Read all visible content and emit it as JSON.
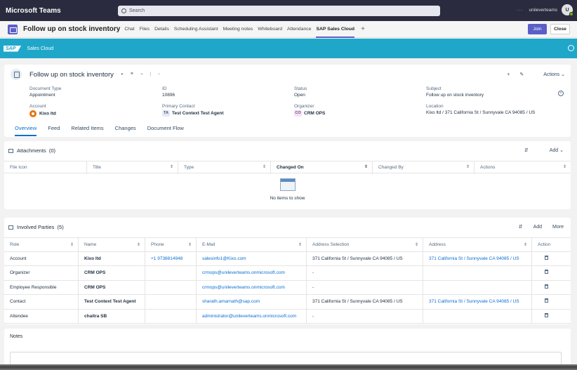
{
  "teams": {
    "title": "Microsoft Teams",
    "search_placeholder": "Search",
    "more": "···",
    "tenant": "unileverteams",
    "avatar_initial": "U"
  },
  "meeting": {
    "title": "Follow up on stock inventory",
    "tabs": [
      "Chat",
      "Files",
      "Details",
      "Scheduling Assistant",
      "Meeting notes",
      "Whiteboard",
      "Attendance",
      "SAP Sales Cloud"
    ],
    "active_tab": "SAP Sales Cloud",
    "add": "+",
    "join": "Join",
    "close": "Close"
  },
  "sap": {
    "logo": "SAP",
    "app": "Sales Cloud"
  },
  "header": {
    "title": "Follow up on stock inventory",
    "actions_label": "Actions",
    "fields": {
      "document_type": {
        "label": "Document Type",
        "value": "Appointment"
      },
      "id": {
        "label": "ID",
        "value": "10896"
      },
      "status": {
        "label": "Status",
        "value": "Open"
      },
      "subject": {
        "label": "Subject",
        "value": "Follow up on stock inventory"
      },
      "account": {
        "label": "Account",
        "value": "Kixo ltd"
      },
      "primary_contact": {
        "label": "Primary Contact",
        "value": "Test Context Test Agent",
        "initials": "TA"
      },
      "organizer": {
        "label": "Organizer",
        "value": "CRM OPS",
        "initials": "CO"
      },
      "location": {
        "label": "Location",
        "value": "Kixo ltd / 371 California St / Sunnyvale CA 94085 / US"
      }
    },
    "tabs": [
      "Overview",
      "Feed",
      "Related Items",
      "Changes",
      "Document Flow"
    ],
    "active_tab": "Overview"
  },
  "attachments": {
    "title": "Attachments",
    "count": "(0)",
    "add": "Add",
    "columns": [
      "File Icon",
      "Title",
      "Type",
      "Changed On",
      "Changed By",
      "Actions"
    ],
    "empty_text": "No items to show"
  },
  "parties": {
    "title": "Involved Parties",
    "count": "(5)",
    "add": "Add",
    "more": "More",
    "columns": [
      "Role",
      "Name",
      "Phone",
      "E-Mail",
      "Address Selection",
      "Address",
      "Action"
    ],
    "rows": [
      {
        "role": "Account",
        "name": "Kixo ltd",
        "phone": "+1 9738814948",
        "email": "salesinfo1@Kixo.com",
        "address_selection": "371 California St / Sunnyvale CA 94085 / US",
        "address": "371 California St / Sunnyvale CA 94085 / US"
      },
      {
        "role": "Organizer",
        "name": "CRM OPS",
        "phone": "",
        "email": "crmops@unileverteams.onmicrosoft.com",
        "address_selection": "-",
        "address": ""
      },
      {
        "role": "Employee Responsible",
        "name": "CRM OPS",
        "phone": "",
        "email": "crmops@unileverteams.onmicrosoft.com",
        "address_selection": "-",
        "address": ""
      },
      {
        "role": "Contact",
        "name": "Test Context Test Agent",
        "phone": "",
        "email": "sharath.amarnath@sap.com",
        "address_selection": "371 California St / Sunnyvale CA 94085 / US",
        "address": "371 California St / Sunnyvale CA 94085 / US"
      },
      {
        "role": "Attendee",
        "name": "chaitra SB",
        "phone": "",
        "email": "administrator@unileverteams.onmicrosoft.com",
        "address_selection": "-",
        "address": ""
      }
    ]
  },
  "notes": {
    "title": "Notes"
  },
  "icons": {
    "sort": "sort-icon",
    "trash": "trash-icon",
    "edit": "pencil-icon",
    "add": "plus-icon"
  },
  "colors": {
    "teams_bar": "#2b2b40",
    "teams_accent": "#5b5fc7",
    "sap_shell": "#1fa7c9",
    "link": "#0a6ed1"
  }
}
